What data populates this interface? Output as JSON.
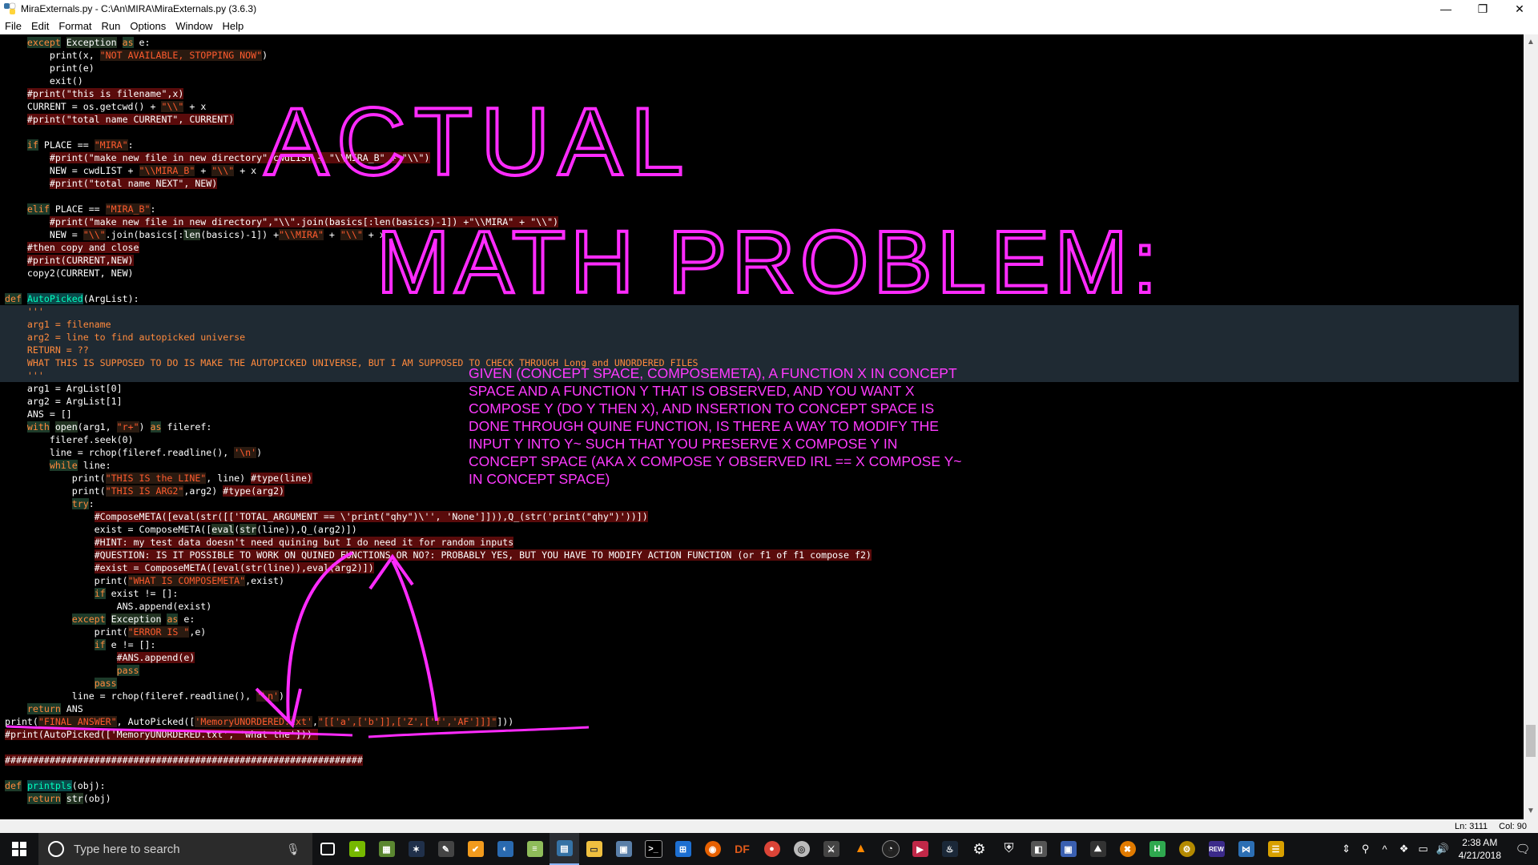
{
  "window": {
    "title": "MiraExternals.py - C:\\An\\MIRA\\MiraExternals.py (3.6.3)",
    "minimize_glyph": "—",
    "maximize_glyph": "❐",
    "close_glyph": "✕"
  },
  "menu": [
    "File",
    "Edit",
    "Format",
    "Run",
    "Options",
    "Window",
    "Help"
  ],
  "status": {
    "line": "Ln: 3111",
    "col": "Col: 90"
  },
  "annotations": {
    "title_line1": "ACTUAL",
    "title_line2": "MATH  PROBLEM:",
    "question": "GIVEN (CONCEPT SPACE, COMPOSEMETA), A FUNCTION X IN CONCEPT SPACE AND A FUNCTION Y THAT IS OBSERVED, AND YOU WANT X COMPOSE Y (DO Y THEN X), AND INSERTION TO CONCEPT SPACE IS DONE THROUGH QUINE FUNCTION, IS THERE A WAY TO MODIFY THE INPUT Y INTO Y~ SUCH THAT YOU PRESERVE X COMPOSE Y IN CONCEPT SPACE (AKA X COMPOSE Y OBSERVED IRL == X COMPOSE Y~ IN CONCEPT SPACE)",
    "color": "#ff3bff"
  },
  "taskbar": {
    "search_placeholder": "Type here to search",
    "time": "2:38 AM",
    "date": "4/21/2018",
    "df_label": "DF",
    "rew_label": "REW",
    "h_label": "H"
  },
  "colors": {
    "keyword": "#ff8a3d",
    "string": "#ff5b2e",
    "defname": "#00ffbf",
    "comment_bg": "#5a0b0b"
  },
  "code": [
    [
      [
        "    ",
        ""
      ],
      [
        "except",
        "kw"
      ],
      [
        " ",
        ""
      ],
      [
        "Exception",
        "bi"
      ],
      [
        " ",
        ""
      ],
      [
        "as",
        "kw"
      ],
      [
        " e:",
        ""
      ]
    ],
    [
      [
        "        print(x, ",
        ""
      ],
      [
        "\"NOT AVAILABLE, STOPPING NOW\"",
        "st"
      ],
      [
        ")",
        ""
      ]
    ],
    [
      [
        "        print(e)",
        ""
      ]
    ],
    [
      [
        "        exit()",
        ""
      ]
    ],
    [
      [
        "    ",
        ""
      ],
      [
        "#print(\"this is filename\",x)",
        "cm"
      ]
    ],
    [
      [
        "    CURRENT = os.getcwd() + ",
        ""
      ],
      [
        "\"\\\\\"",
        "st"
      ],
      [
        " + x",
        ""
      ]
    ],
    [
      [
        "    ",
        ""
      ],
      [
        "#print(\"total name CURRENT\", CURRENT)",
        "cm"
      ]
    ],
    [
      [
        "",
        ""
      ]
    ],
    [
      [
        "    ",
        ""
      ],
      [
        "if",
        "kw"
      ],
      [
        " PLACE == ",
        ""
      ],
      [
        "\"MIRA\"",
        "st"
      ],
      [
        ":",
        ""
      ]
    ],
    [
      [
        "        ",
        ""
      ],
      [
        "#print(\"make new file in new directory\",cwdLIST + \"\\\\MIRA_B\" + \"\\\\\")",
        "cm"
      ]
    ],
    [
      [
        "        NEW = cwdLIST + ",
        ""
      ],
      [
        "\"\\\\MIRA_B\"",
        "st"
      ],
      [
        " + ",
        ""
      ],
      [
        "\"\\\\\"",
        "st"
      ],
      [
        " + x",
        ""
      ]
    ],
    [
      [
        "        ",
        ""
      ],
      [
        "#print(\"total name NEXT\", NEW)",
        "cm"
      ]
    ],
    [
      [
        "",
        ""
      ]
    ],
    [
      [
        "    ",
        ""
      ],
      [
        "elif",
        "kw"
      ],
      [
        " PLACE == ",
        ""
      ],
      [
        "\"MIRA_B\"",
        "st"
      ],
      [
        ":",
        ""
      ]
    ],
    [
      [
        "        ",
        ""
      ],
      [
        "#print(\"make new file in new directory\",\"\\\\\".join(basics[:len(basics)-1]) +\"\\\\MIRA\" + \"\\\\\")",
        "cm"
      ]
    ],
    [
      [
        "        NEW = ",
        ""
      ],
      [
        "\"\\\\\"",
        "st"
      ],
      [
        ".join(basics[:",
        ""
      ],
      [
        "len",
        "bi"
      ],
      [
        "(basics)-1]) +",
        ""
      ],
      [
        "\"\\\\MIRA\"",
        "st"
      ],
      [
        " + ",
        ""
      ],
      [
        "\"\\\\\"",
        "st"
      ],
      [
        " + x",
        ""
      ]
    ],
    [
      [
        "    ",
        ""
      ],
      [
        "#then copy and close",
        "cm"
      ]
    ],
    [
      [
        "    ",
        ""
      ],
      [
        "#print(CURRENT,NEW)",
        "cm"
      ]
    ],
    [
      [
        "    copy2(CURRENT, NEW)",
        ""
      ]
    ],
    [
      [
        "",
        ""
      ]
    ],
    [
      [
        "def",
        "kw"
      ],
      [
        " ",
        ""
      ],
      [
        "AutoPicked",
        "fn"
      ],
      [
        "(ArgList):",
        ""
      ]
    ],
    [
      [
        "    ",
        ""
      ],
      [
        "'''",
        "ds"
      ]
    ],
    [
      [
        "    ",
        ""
      ],
      [
        "arg1 = filename",
        "ds"
      ]
    ],
    [
      [
        "    ",
        ""
      ],
      [
        "arg2 = line to find autopicked universe",
        "ds"
      ]
    ],
    [
      [
        "    ",
        ""
      ],
      [
        "RETURN = ??",
        "ds"
      ]
    ],
    [
      [
        "    ",
        ""
      ],
      [
        "WHAT THIS IS SUPPOSED TO DO IS MAKE THE AUTOPICKED UNIVERSE, BUT I AM SUPPOSED TO CHECK THROUGH Long and UNORDERED FILES",
        "ds"
      ]
    ],
    [
      [
        "    ",
        ""
      ],
      [
        "'''",
        "ds"
      ]
    ],
    [
      [
        "    arg1 = ArgList[0]",
        ""
      ]
    ],
    [
      [
        "    arg2 = ArgList[1]",
        ""
      ]
    ],
    [
      [
        "    ANS = []",
        ""
      ]
    ],
    [
      [
        "    ",
        ""
      ],
      [
        "with",
        "kw"
      ],
      [
        " ",
        ""
      ],
      [
        "open",
        "bi"
      ],
      [
        "(arg1, ",
        ""
      ],
      [
        "\"r+\"",
        "st"
      ],
      [
        ") ",
        ""
      ],
      [
        "as",
        "kw"
      ],
      [
        " fileref:",
        ""
      ]
    ],
    [
      [
        "        fileref.seek(0)",
        ""
      ]
    ],
    [
      [
        "        line = rchop(fileref.readline(), ",
        ""
      ],
      [
        "'\\n'",
        "st"
      ],
      [
        ")",
        ""
      ]
    ],
    [
      [
        "        ",
        ""
      ],
      [
        "while",
        "kw"
      ],
      [
        " line:",
        ""
      ]
    ],
    [
      [
        "            print(",
        ""
      ],
      [
        "\"THIS IS the LINE\"",
        "st"
      ],
      [
        ", line) ",
        ""
      ],
      [
        "#type(line)",
        "cm"
      ]
    ],
    [
      [
        "            print(",
        ""
      ],
      [
        "\"THIS IS ARG2\"",
        "st"
      ],
      [
        ",arg2) ",
        ""
      ],
      [
        "#type(arg2)",
        "cm"
      ]
    ],
    [
      [
        "            ",
        ""
      ],
      [
        "try",
        "kw"
      ],
      [
        ":",
        ""
      ]
    ],
    [
      [
        "                ",
        ""
      ],
      [
        "#ComposeMETA([eval(str([['TOTAL_ARGUMENT == \\'print(\"qhy\")\\'', 'None']])),Q_(str('print(\"qhy\")'))])",
        "cm"
      ]
    ],
    [
      [
        "                exist = ComposeMETA([",
        ""
      ],
      [
        "eval",
        "bi"
      ],
      [
        "(",
        ""
      ],
      [
        "str",
        "bi"
      ],
      [
        "(line)),Q_(arg2)])",
        ""
      ]
    ],
    [
      [
        "                ",
        ""
      ],
      [
        "#HINT: my test data doesn't need quining but I do need it for random inputs",
        "cm"
      ]
    ],
    [
      [
        "                ",
        ""
      ],
      [
        "#QUESTION: IS IT POSSIBLE TO WORK ON QUINED FUNCTIONS OR NO?: PROBABLY YES, BUT YOU HAVE TO MODIFY ACTION FUNCTION (or f1 of f1 compose f2)",
        "cm"
      ]
    ],
    [
      [
        "                ",
        ""
      ],
      [
        "#exist = ComposeMETA([eval(str(line)),eval(arg2)])",
        "cm"
      ]
    ],
    [
      [
        "                print(",
        ""
      ],
      [
        "\"WHAT IS COMPOSEMETA\"",
        "st"
      ],
      [
        ",exist)",
        ""
      ]
    ],
    [
      [
        "                ",
        ""
      ],
      [
        "if",
        "kw"
      ],
      [
        " exist != []:",
        ""
      ]
    ],
    [
      [
        "                    ANS.append(exist)",
        ""
      ]
    ],
    [
      [
        "            ",
        ""
      ],
      [
        "except",
        "kw"
      ],
      [
        " ",
        ""
      ],
      [
        "Exception",
        "bi"
      ],
      [
        " ",
        ""
      ],
      [
        "as",
        "kw"
      ],
      [
        " e:",
        ""
      ]
    ],
    [
      [
        "                print(",
        ""
      ],
      [
        "\"ERROR IS \"",
        "st"
      ],
      [
        ",e)",
        ""
      ]
    ],
    [
      [
        "                ",
        ""
      ],
      [
        "if",
        "kw"
      ],
      [
        " e != []:",
        ""
      ]
    ],
    [
      [
        "                    ",
        ""
      ],
      [
        "#ANS.append(e)",
        "cm"
      ]
    ],
    [
      [
        "                    ",
        ""
      ],
      [
        "pass",
        "kw"
      ]
    ],
    [
      [
        "                ",
        ""
      ],
      [
        "pass",
        "kw"
      ]
    ],
    [
      [
        "            line = rchop(fileref.readline(), ",
        ""
      ],
      [
        "'\\n'",
        "st"
      ],
      [
        ")",
        ""
      ]
    ],
    [
      [
        "    ",
        ""
      ],
      [
        "return",
        "kw"
      ],
      [
        " ANS",
        ""
      ]
    ],
    [
      [
        "print(",
        ""
      ],
      [
        "\"FINAL ANSWER\"",
        "st"
      ],
      [
        ", AutoPicked([",
        ""
      ],
      [
        "'MemoryUNORDERED.txt'",
        "st"
      ],
      [
        ",",
        ""
      ],
      [
        "\"[['a',['b']],['Z',['f','AF']]]\"",
        "st"
      ],
      [
        "]))",
        ""
      ]
    ],
    [
      [
        "#print(AutoPicked(['MemoryUNORDERED.txt', 'what the'])) ",
        "cm"
      ]
    ],
    [
      [
        "",
        ""
      ]
    ],
    [
      [
        "################################################################",
        "cm"
      ]
    ],
    [
      [
        "",
        ""
      ]
    ],
    [
      [
        "def",
        "kw"
      ],
      [
        " ",
        ""
      ],
      [
        "printpls",
        "fn"
      ],
      [
        "(obj):",
        ""
      ]
    ],
    [
      [
        "    ",
        ""
      ],
      [
        "return",
        "kw"
      ],
      [
        " ",
        ""
      ],
      [
        "str",
        "bi"
      ],
      [
        "(obj)",
        ""
      ]
    ]
  ]
}
